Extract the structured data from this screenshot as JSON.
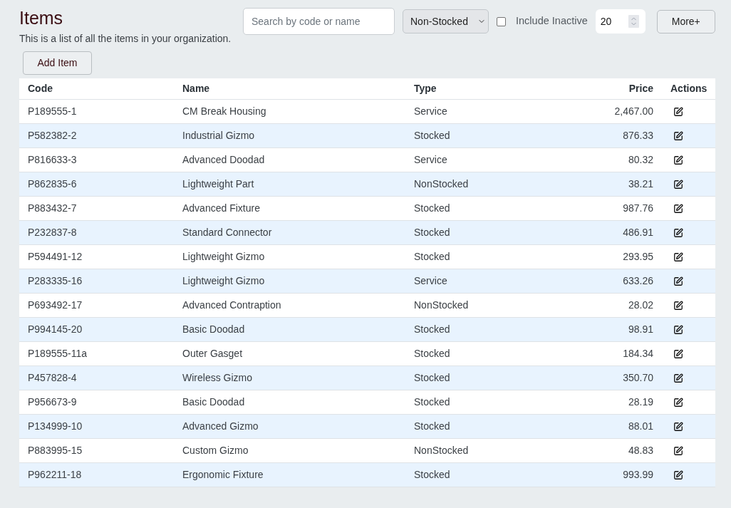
{
  "header": {
    "title": "Items",
    "description": "This is a list of all the items in your organization."
  },
  "toolbar": {
    "search": {
      "placeholder": "Search by code or name"
    },
    "type_filter": {
      "value": "Non-Stocked"
    },
    "include_inactive": {
      "label": "Include Inactive",
      "checked": false
    },
    "page_size": {
      "value": "20"
    },
    "more_button": {
      "label": "More+"
    }
  },
  "add_button": {
    "label": "Add Item"
  },
  "table": {
    "columns": [
      "Code",
      "Name",
      "Type",
      "Price",
      "Actions"
    ],
    "rows": [
      {
        "cells": [
          "P189555-1",
          "CM Break Housing",
          "Service",
          "2,467.00"
        ]
      },
      {
        "cells": [
          "P582382-2",
          "Industrial Gizmo",
          "Stocked",
          "876.33"
        ]
      },
      {
        "cells": [
          "P816633-3",
          "Advanced Doodad",
          "Service",
          "80.32"
        ]
      },
      {
        "cells": [
          "P862835-6",
          "Lightweight Part",
          "NonStocked",
          "38.21"
        ]
      },
      {
        "cells": [
          "P883432-7",
          "Advanced Fixture",
          "Stocked",
          "987.76"
        ]
      },
      {
        "cells": [
          "P232837-8",
          "Standard Connector",
          "Stocked",
          "486.91"
        ]
      },
      {
        "cells": [
          "P594491-12",
          "Lightweight Gizmo",
          "Stocked",
          "293.95"
        ]
      },
      {
        "cells": [
          "P283335-16",
          "Lightweight Gizmo",
          "Service",
          "633.26"
        ]
      },
      {
        "cells": [
          "P693492-17",
          "Advanced Contraption",
          "NonStocked",
          "28.02"
        ]
      },
      {
        "cells": [
          "P994145-20",
          "Basic Doodad",
          "Stocked",
          "98.91"
        ]
      },
      {
        "cells": [
          "P189555-11a",
          "Outer Gasget",
          "Stocked",
          "184.34"
        ]
      },
      {
        "cells": [
          "P457828-4",
          "Wireless Gizmo",
          "Stocked",
          "350.70"
        ]
      },
      {
        "cells": [
          "P956673-9",
          "Basic Doodad",
          "Stocked",
          "28.19"
        ]
      },
      {
        "cells": [
          "P134999-10",
          "Advanced Gizmo",
          "Stocked",
          "88.01"
        ]
      },
      {
        "cells": [
          "P883995-15",
          "Custom Gizmo",
          "NonStocked",
          "48.83"
        ]
      },
      {
        "cells": [
          "P962211-18",
          "Ergonomic Fixture",
          "Stocked",
          "993.99"
        ]
      }
    ]
  }
}
